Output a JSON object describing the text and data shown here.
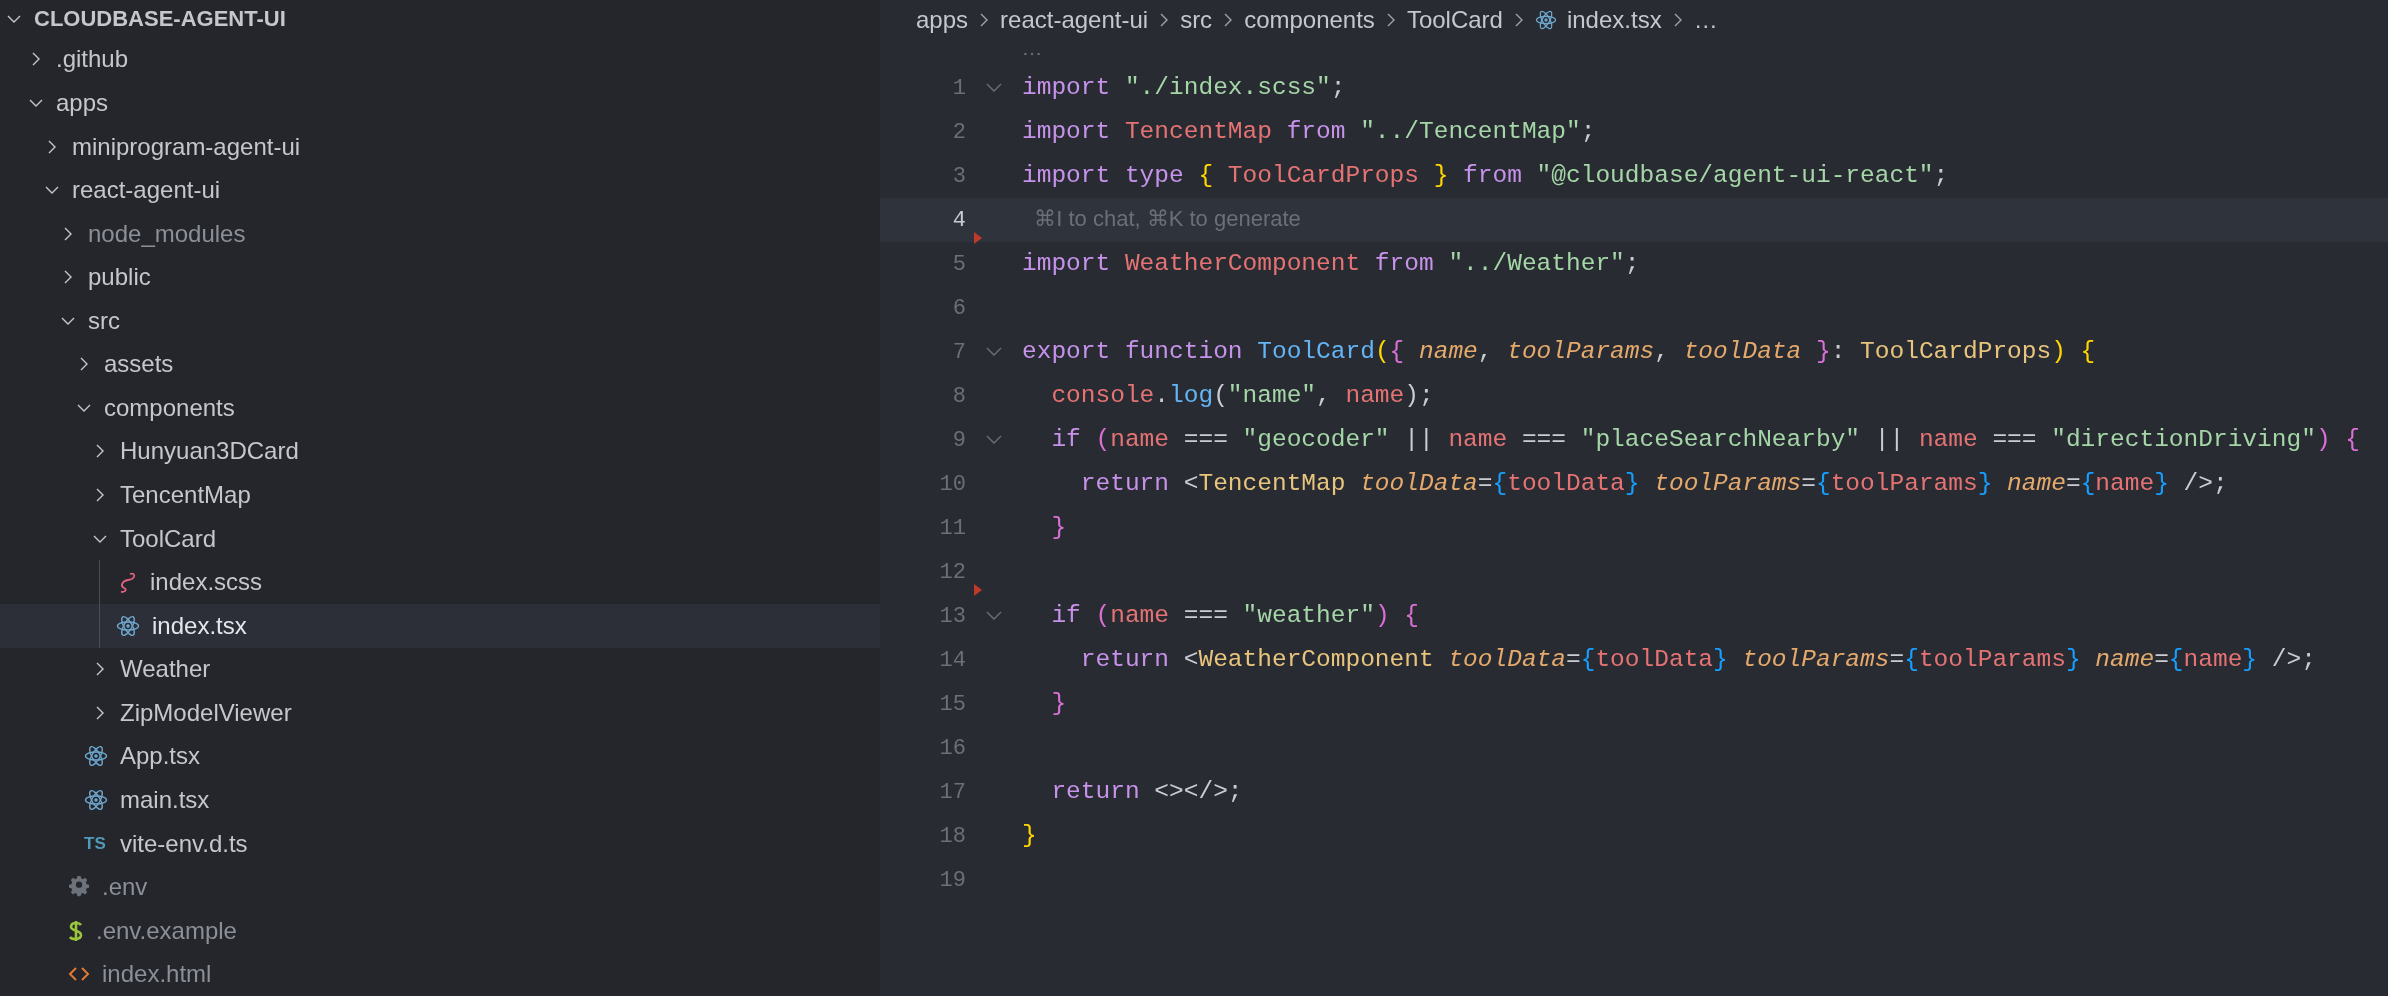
{
  "explorer": {
    "title": "CLOUDBASE-AGENT-UI",
    "expanded": true,
    "items": [
      {
        "name": ".github",
        "kind": "folder",
        "expanded": false,
        "dimmed": false,
        "selected": false
      },
      {
        "name": "apps",
        "kind": "folder",
        "expanded": true,
        "dimmed": false,
        "selected": false,
        "children": [
          {
            "name": "miniprogram-agent-ui",
            "kind": "folder",
            "expanded": false,
            "dimmed": false,
            "selected": false
          },
          {
            "name": "react-agent-ui",
            "kind": "folder",
            "expanded": true,
            "dimmed": false,
            "selected": false,
            "children": [
              {
                "name": "node_modules",
                "kind": "folder",
                "expanded": false,
                "dimmed": true,
                "selected": false
              },
              {
                "name": "public",
                "kind": "folder",
                "expanded": false,
                "dimmed": false,
                "selected": false
              },
              {
                "name": "src",
                "kind": "folder",
                "expanded": true,
                "dimmed": false,
                "selected": false,
                "children": [
                  {
                    "name": "assets",
                    "kind": "folder",
                    "expanded": false,
                    "dimmed": false,
                    "selected": false
                  },
                  {
                    "name": "components",
                    "kind": "folder",
                    "expanded": true,
                    "dimmed": false,
                    "selected": false,
                    "children": [
                      {
                        "name": "Hunyuan3DCard",
                        "kind": "folder",
                        "expanded": false,
                        "dimmed": false,
                        "selected": false
                      },
                      {
                        "name": "TencentMap",
                        "kind": "folder",
                        "expanded": false,
                        "dimmed": false,
                        "selected": false
                      },
                      {
                        "name": "ToolCard",
                        "kind": "folder",
                        "expanded": true,
                        "dimmed": false,
                        "selected": false,
                        "children": [
                          {
                            "name": "index.scss",
                            "kind": "scss",
                            "dimmed": false,
                            "selected": false
                          },
                          {
                            "name": "index.tsx",
                            "kind": "react",
                            "dimmed": false,
                            "selected": true
                          }
                        ]
                      },
                      {
                        "name": "Weather",
                        "kind": "folder",
                        "expanded": false,
                        "dimmed": false,
                        "selected": false
                      },
                      {
                        "name": "ZipModelViewer",
                        "kind": "folder",
                        "expanded": false,
                        "dimmed": false,
                        "selected": false
                      }
                    ]
                  },
                  {
                    "name": "App.tsx",
                    "kind": "react",
                    "dimmed": false,
                    "selected": false
                  },
                  {
                    "name": "main.tsx",
                    "kind": "react",
                    "dimmed": false,
                    "selected": false
                  },
                  {
                    "name": "vite-env.d.ts",
                    "kind": "ts",
                    "badge": "TS",
                    "dimmed": false,
                    "selected": false
                  }
                ]
              },
              {
                "name": ".env",
                "kind": "gear",
                "dimmed": true,
                "selected": false
              },
              {
                "name": ".env.example",
                "kind": "dollar",
                "dimmed": true,
                "selected": false
              },
              {
                "name": "index.html",
                "kind": "html",
                "dimmed": true,
                "selected": false
              }
            ]
          }
        ]
      }
    ]
  },
  "breadcrumb": [
    {
      "text": "apps",
      "kind": "folder"
    },
    {
      "text": "react-agent-ui",
      "kind": "folder"
    },
    {
      "text": "src",
      "kind": "folder"
    },
    {
      "text": "components",
      "kind": "folder"
    },
    {
      "text": "ToolCard",
      "kind": "folder"
    },
    {
      "text": "index.tsx",
      "kind": "react"
    },
    {
      "text": "…",
      "kind": "more"
    }
  ],
  "editor": {
    "codelens": "⋯",
    "lines": [
      {
        "number": "1",
        "foldable": true,
        "current": false,
        "marker": false,
        "tokens": [
          {
            "text": "import",
            "kind": "kw"
          },
          {
            "text": " \"./index.scss\"",
            "kind": "str"
          },
          {
            "text": ";",
            "kind": "plain"
          }
        ]
      },
      {
        "number": "2",
        "foldable": false,
        "current": false,
        "marker": false,
        "tokens": [
          {
            "text": "import",
            "kind": "kw"
          },
          {
            "text": " TencentMap",
            "kind": "var"
          },
          {
            "text": " from",
            "kind": "kw"
          },
          {
            "text": " \"../TencentMap\"",
            "kind": "str"
          },
          {
            "text": ";",
            "kind": "plain"
          }
        ]
      },
      {
        "number": "3",
        "foldable": false,
        "current": false,
        "marker": false,
        "tokens": [
          {
            "text": "import",
            "kind": "kw"
          },
          {
            "text": " type",
            "kind": "kw"
          },
          {
            "text": " {",
            "kind": "b1"
          },
          {
            "text": " ToolCardProps",
            "kind": "var"
          },
          {
            "text": " }",
            "kind": "b1"
          },
          {
            "text": " from",
            "kind": "kw"
          },
          {
            "text": " \"@cloudbase/agent-ui-react\"",
            "kind": "str"
          },
          {
            "text": ";",
            "kind": "plain"
          }
        ]
      },
      {
        "number": "4",
        "foldable": false,
        "current": true,
        "marker": false,
        "tokens": [
          {
            "text": "  ⌘I to chat, ⌘K to generate",
            "kind": "hint"
          }
        ]
      },
      {
        "number": "5",
        "foldable": false,
        "current": false,
        "marker": true,
        "tokens": [
          {
            "text": "import",
            "kind": "kw"
          },
          {
            "text": " WeatherComponent",
            "kind": "var"
          },
          {
            "text": " from",
            "kind": "kw"
          },
          {
            "text": " \"../Weather\"",
            "kind": "str"
          },
          {
            "text": ";",
            "kind": "plain"
          }
        ]
      },
      {
        "number": "6",
        "foldable": false,
        "current": false,
        "marker": false
      },
      {
        "number": "7",
        "foldable": true,
        "current": false,
        "marker": false,
        "tokens": [
          {
            "text": "export",
            "kind": "kw"
          },
          {
            "text": " function",
            "kind": "kw"
          },
          {
            "text": " ToolCard",
            "kind": "fn"
          },
          {
            "text": "(",
            "kind": "b1"
          },
          {
            "text": "{",
            "kind": "b2"
          },
          {
            "text": " name",
            "kind": "param"
          },
          {
            "text": ",",
            "kind": "plain"
          },
          {
            "text": " toolParams",
            "kind": "param"
          },
          {
            "text": ",",
            "kind": "plain"
          },
          {
            "text": " toolData",
            "kind": "param"
          },
          {
            "text": " }",
            "kind": "b2"
          },
          {
            "text": ":",
            "kind": "plain"
          },
          {
            "text": " ToolCardProps",
            "kind": "cls"
          },
          {
            "text": ")",
            "kind": "b1"
          },
          {
            "text": " {",
            "kind": "b1"
          }
        ]
      },
      {
        "number": "8",
        "foldable": false,
        "current": false,
        "marker": false,
        "tokens": [
          {
            "text": "  console",
            "kind": "var"
          },
          {
            "text": ".",
            "kind": "plain"
          },
          {
            "text": "log",
            "kind": "fn"
          },
          {
            "text": "(",
            "kind": "plain"
          },
          {
            "text": "\"name\"",
            "kind": "str"
          },
          {
            "text": ",",
            "kind": "plain"
          },
          {
            "text": " name",
            "kind": "var"
          },
          {
            "text": ");",
            "kind": "plain"
          }
        ]
      },
      {
        "number": "9",
        "foldable": true,
        "current": false,
        "marker": false,
        "tokens": [
          {
            "text": "  if",
            "kind": "kw"
          },
          {
            "text": " (",
            "kind": "b2"
          },
          {
            "text": "name",
            "kind": "var"
          },
          {
            "text": " ===",
            "kind": "plain"
          },
          {
            "text": " \"geocoder\"",
            "kind": "str"
          },
          {
            "text": " ||",
            "kind": "plain"
          },
          {
            "text": " name",
            "kind": "var"
          },
          {
            "text": " ===",
            "kind": "plain"
          },
          {
            "text": " \"placeSearchNearby\"",
            "kind": "str"
          },
          {
            "text": " ||",
            "kind": "plain"
          },
          {
            "text": " name",
            "kind": "var"
          },
          {
            "text": " ===",
            "kind": "plain"
          },
          {
            "text": " \"directionDriving\"",
            "kind": "str"
          },
          {
            "text": ")",
            "kind": "b2"
          },
          {
            "text": " {",
            "kind": "b2"
          }
        ]
      },
      {
        "number": "10",
        "foldable": false,
        "current": false,
        "marker": false,
        "tokens": [
          {
            "text": "    return",
            "kind": "kw"
          },
          {
            "text": " <",
            "kind": "plain"
          },
          {
            "text": "TencentMap",
            "kind": "cls"
          },
          {
            "text": " toolData",
            "kind": "param"
          },
          {
            "text": "=",
            "kind": "plain"
          },
          {
            "text": "{",
            "kind": "b3"
          },
          {
            "text": "toolData",
            "kind": "var"
          },
          {
            "text": "}",
            "kind": "b3"
          },
          {
            "text": " toolParams",
            "kind": "param"
          },
          {
            "text": "=",
            "kind": "plain"
          },
          {
            "text": "{",
            "kind": "b3"
          },
          {
            "text": "toolParams",
            "kind": "var"
          },
          {
            "text": "}",
            "kind": "b3"
          },
          {
            "text": " name",
            "kind": "param"
          },
          {
            "text": "=",
            "kind": "plain"
          },
          {
            "text": "{",
            "kind": "b3"
          },
          {
            "text": "name",
            "kind": "var"
          },
          {
            "text": "}",
            "kind": "b3"
          },
          {
            "text": " />;",
            "kind": "plain"
          }
        ]
      },
      {
        "number": "11",
        "foldable": false,
        "current": false,
        "marker": false,
        "tokens": [
          {
            "text": "  }",
            "kind": "b2"
          }
        ]
      },
      {
        "number": "12",
        "foldable": false,
        "current": false,
        "marker": false
      },
      {
        "number": "13",
        "foldable": true,
        "current": false,
        "marker": true,
        "tokens": [
          {
            "text": "  if",
            "kind": "kw"
          },
          {
            "text": " (",
            "kind": "b2"
          },
          {
            "text": "name",
            "kind": "var"
          },
          {
            "text": " ===",
            "kind": "plain"
          },
          {
            "text": " \"weather\"",
            "kind": "str"
          },
          {
            "text": ")",
            "kind": "b2"
          },
          {
            "text": " {",
            "kind": "b2"
          }
        ]
      },
      {
        "number": "14",
        "foldable": false,
        "current": false,
        "marker": false,
        "tokens": [
          {
            "text": "    return",
            "kind": "kw"
          },
          {
            "text": " <",
            "kind": "plain"
          },
          {
            "text": "WeatherComponent",
            "kind": "cls"
          },
          {
            "text": " toolData",
            "kind": "param"
          },
          {
            "text": "=",
            "kind": "plain"
          },
          {
            "text": "{",
            "kind": "b3"
          },
          {
            "text": "toolData",
            "kind": "var"
          },
          {
            "text": "}",
            "kind": "b3"
          },
          {
            "text": " toolParams",
            "kind": "param"
          },
          {
            "text": "=",
            "kind": "plain"
          },
          {
            "text": "{",
            "kind": "b3"
          },
          {
            "text": "toolParams",
            "kind": "var"
          },
          {
            "text": "}",
            "kind": "b3"
          },
          {
            "text": " name",
            "kind": "param"
          },
          {
            "text": "=",
            "kind": "plain"
          },
          {
            "text": "{",
            "kind": "b3"
          },
          {
            "text": "name",
            "kind": "var"
          },
          {
            "text": "}",
            "kind": "b3"
          },
          {
            "text": " />;",
            "kind": "plain"
          }
        ]
      },
      {
        "number": "15",
        "foldable": false,
        "current": false,
        "marker": false,
        "tokens": [
          {
            "text": "  }",
            "kind": "b2"
          }
        ]
      },
      {
        "number": "16",
        "foldable": false,
        "current": false,
        "marker": false
      },
      {
        "number": "17",
        "foldable": false,
        "current": false,
        "marker": false,
        "tokens": [
          {
            "text": "  return",
            "kind": "kw"
          },
          {
            "text": " <></>;",
            "kind": "plain"
          }
        ]
      },
      {
        "number": "18",
        "foldable": false,
        "current": false,
        "marker": false,
        "tokens": [
          {
            "text": "}",
            "kind": "b1"
          }
        ]
      },
      {
        "number": "19",
        "foldable": false,
        "current": false,
        "marker": false
      }
    ]
  }
}
